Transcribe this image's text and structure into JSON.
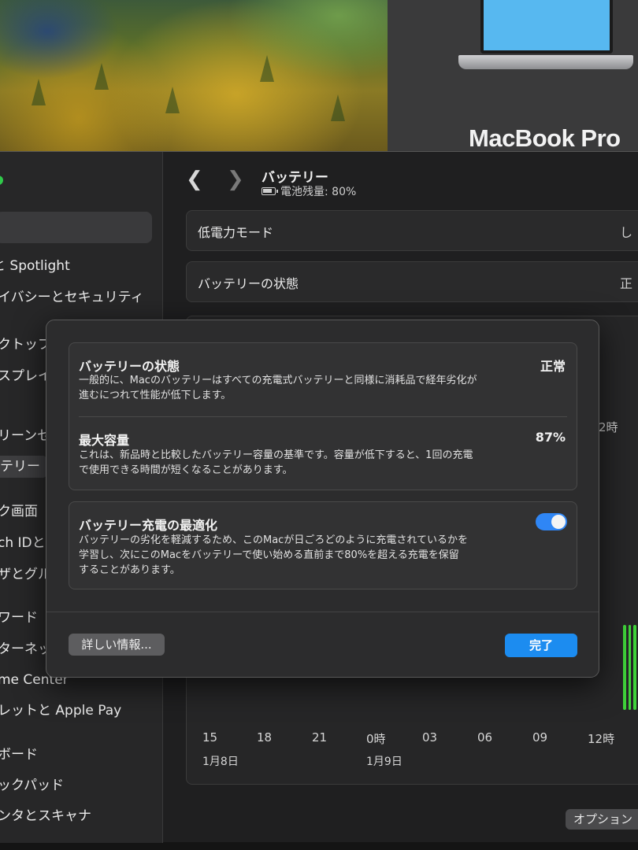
{
  "about": {
    "model_name": "MacBook Pro"
  },
  "sidebar": {
    "items": [
      {
        "label": "と Spotlight"
      },
      {
        "label": "イバシーとセキュリティ"
      },
      {
        "label": "クトップ"
      },
      {
        "label": "スプレイ"
      },
      {
        "label": "リーンセ"
      },
      {
        "label": "テリー"
      },
      {
        "label": "ク画面"
      },
      {
        "label": "ch IDと"
      },
      {
        "label": "ザとグル"
      },
      {
        "label": "ワード"
      },
      {
        "label": "ターネッ"
      },
      {
        "label": "me Center"
      },
      {
        "label": "レットと Apple Pay"
      },
      {
        "label": "ボード"
      },
      {
        "label": "ックパッド"
      },
      {
        "label": "ンタとスキャナ"
      }
    ]
  },
  "main": {
    "title": "バッテリー",
    "battery_level": "電池残量: 80%",
    "rows": [
      {
        "label": "低電力モード",
        "value": "し"
      },
      {
        "label": "バッテリーの状態",
        "value": "正"
      }
    ],
    "chart_ticks": {
      "times": [
        "15",
        "18",
        "21",
        "0時",
        "03",
        "06",
        "09",
        "12時"
      ],
      "dates": [
        "1月8日",
        "1月9日"
      ],
      "partial_time": "2時"
    },
    "options_label": "オプション"
  },
  "modal": {
    "battery_health": {
      "title": "バッテリーの状態",
      "value": "正常",
      "desc_line1": "一般的に、Macのバッテリーはすべての充電式バッテリーと同様に消耗品で経年劣化が",
      "desc_line2": "進むにつれて性能が低下します。"
    },
    "max_capacity": {
      "title": "最大容量",
      "value": "87%",
      "desc_line1": "これは、新品時と比較したバッテリー容量の基準です。容量が低下すると、1回の充電",
      "desc_line2": "で使用できる時間が短くなることがあります。"
    },
    "optimized_charging": {
      "title": "バッテリー充電の最適化",
      "enabled": true,
      "desc_line1": "バッテリーの劣化を軽減するため、このMacが日ごろどのように充電されているかを",
      "desc_line2": "学習し、次にこのMacをバッテリーで使い始める直前まで80%を超える充電を保留",
      "desc_line3": "することがあります。"
    },
    "details_button": "詳しい情報...",
    "done_button": "完了"
  }
}
